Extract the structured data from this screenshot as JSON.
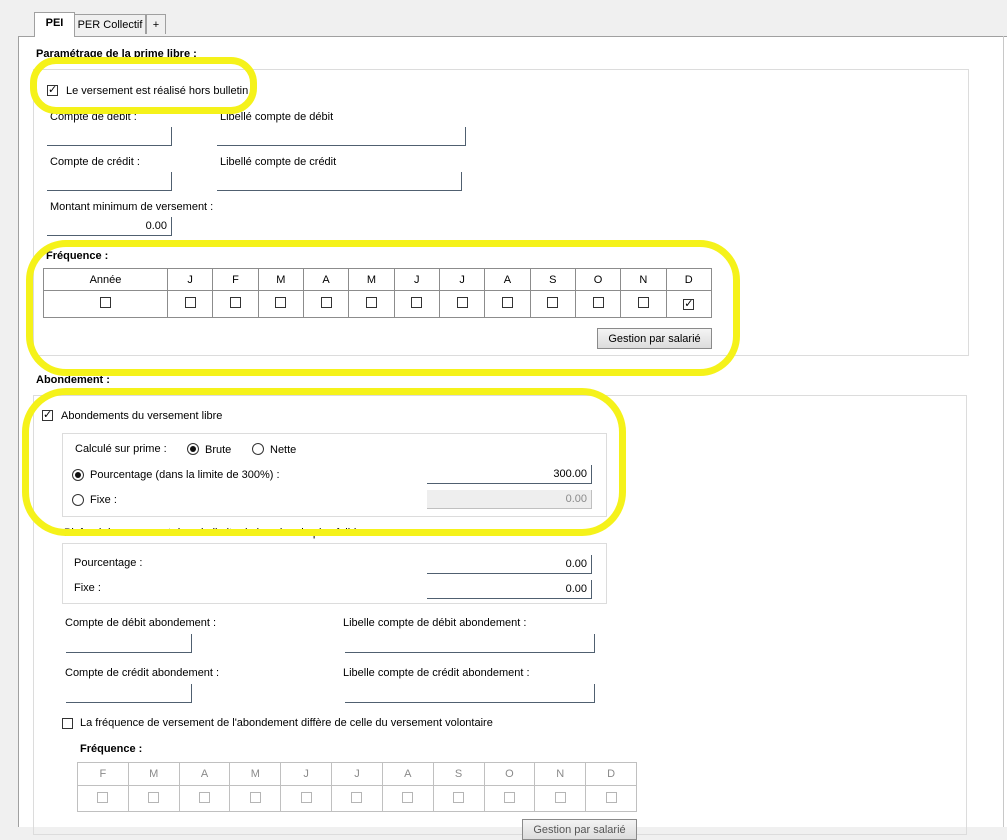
{
  "tabs": [
    {
      "label": "PEI",
      "active": true
    },
    {
      "label": "PER Collectif",
      "active": false
    },
    {
      "label": "+",
      "active": false
    }
  ],
  "prime": {
    "section_title": "Paramétrage de la prime libre :",
    "hors_bulletin_label": "Le versement est réalisé hors bulletin",
    "hors_bulletin_checked": true,
    "compte_debit_label": "Compte de débit :",
    "libelle_debit_label": "Libellé compte de débit",
    "compte_credit_label": "Compte de crédit :",
    "libelle_credit_label": "Libellé compte de crédit",
    "montant_min_label": "Montant minimum de versement :",
    "montant_min_value": "0.00",
    "frequence_title": "Fréquence :",
    "frequence_headers": [
      "Année",
      "J",
      "F",
      "M",
      "A",
      "M",
      "J",
      "J",
      "A",
      "S",
      "O",
      "N",
      "D"
    ],
    "frequence_checked": [
      false,
      false,
      false,
      false,
      false,
      false,
      false,
      false,
      false,
      false,
      false,
      false,
      true
    ],
    "gestion_button": "Gestion par salarié"
  },
  "abondement": {
    "section_title": "Abondement :",
    "abondements_label": "Abondements du versement libre",
    "abondements_checked": true,
    "calcule_label": "Calculé sur prime :",
    "brute_label": "Brute",
    "nette_label": "Nette",
    "pourcentage_label": "Pourcentage (dans la limite de 300%) :",
    "pourcentage_value": "300.00",
    "fixe_label": "Fixe :",
    "fixe_value": "0.00",
    "plafond_title": "Plafond du versement dans la limite de la valeur la plus faible :",
    "plafond_pourcentage_label": "Pourcentage :",
    "plafond_pourcentage_value": "0.00",
    "plafond_fixe_label": "Fixe :",
    "plafond_fixe_value": "0.00",
    "compte_debit_ab_label": "Compte de débit abondement :",
    "libelle_debit_ab_label": "Libelle compte de débit abondement :",
    "compte_credit_ab_label": "Compte de crédit abondement :",
    "libelle_credit_ab_label": "Libelle compte de crédit abondement :",
    "frequence_differe_label": "La fréquence de versement de l'abondement diffère de celle du versement volontaire",
    "frequence_differe_checked": false,
    "frequence_title": "Fréquence :",
    "frequence_headers": [
      "F",
      "M",
      "A",
      "M",
      "J",
      "J",
      "A",
      "S",
      "O",
      "N",
      "D"
    ],
    "gestion_button": "Gestion par salarié"
  },
  "colors": {
    "highlight": "#f5f21a",
    "field_border": "#506070",
    "background": "#f0f0f0"
  }
}
